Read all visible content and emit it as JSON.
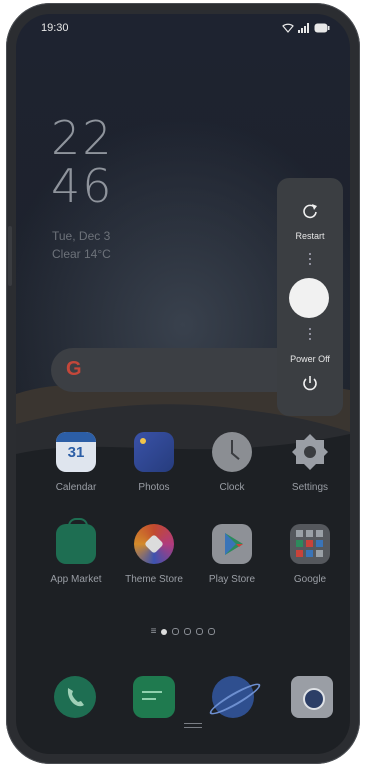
{
  "status_bar": {
    "time": "19:30",
    "icons": [
      "wifi-icon",
      "signal-icon",
      "battery-icon"
    ]
  },
  "lock_clock": {
    "hours": "22",
    "minutes": "46",
    "date": "Tue, Dec 3",
    "weather": "Clear 14°C"
  },
  "search_bar": {
    "logo_letter": "G"
  },
  "power_menu": {
    "restart_label": "Restart",
    "power_off_label": "Power Off"
  },
  "apps_row1": [
    {
      "label": "Calendar",
      "icon": "calendar-icon",
      "badge": "31"
    },
    {
      "label": "Photos",
      "icon": "photos-icon"
    },
    {
      "label": "Clock",
      "icon": "clock-icon"
    },
    {
      "label": "Settings",
      "icon": "settings-icon"
    }
  ],
  "apps_row2": [
    {
      "label": "App Market",
      "icon": "app-market-icon"
    },
    {
      "label": "Theme Store",
      "icon": "theme-store-icon"
    },
    {
      "label": "Play Store",
      "icon": "play-store-icon"
    },
    {
      "label": "Google",
      "icon": "google-folder-icon"
    }
  ],
  "page_indicator": {
    "pages": 5,
    "current": 1
  },
  "dock": [
    "phone-icon",
    "messages-icon",
    "browser-icon",
    "camera-icon"
  ],
  "colors": {
    "accent_green": "#1e6e52",
    "calendar_blue": "#2c5ea6",
    "power_menu_bg": "#3b3e42"
  }
}
